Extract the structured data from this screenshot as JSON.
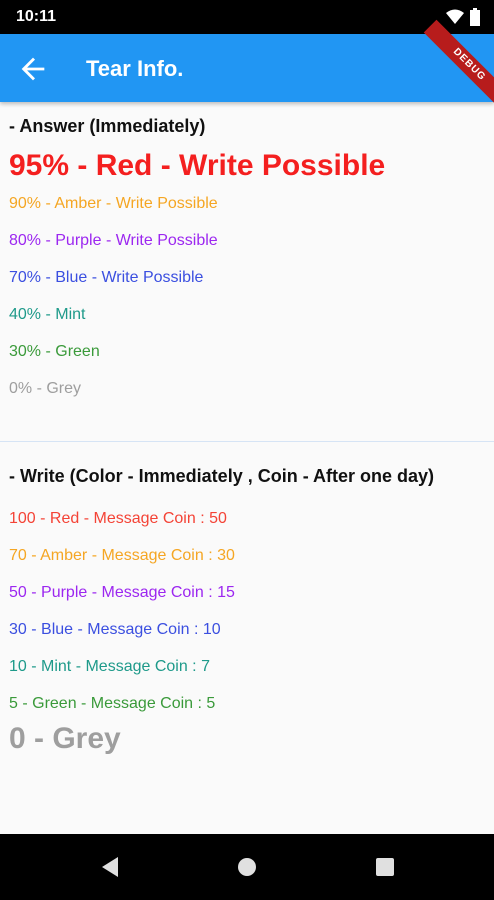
{
  "status_bar": {
    "time": "10:11"
  },
  "app_bar": {
    "title": "Tear Info.",
    "debug_banner": "DEBUG"
  },
  "answer": {
    "heading": "- Answer (Immediately)",
    "rows": [
      {
        "text": "95% - Red  - Write Possible",
        "color": "#f41f1f"
      },
      {
        "text": "90% - Amber  - Write Possible",
        "color": "#f5a623"
      },
      {
        "text": "80% - Purple  - Write Possible",
        "color": "#9c27f0"
      },
      {
        "text": "70% - Blue  - Write Possible",
        "color": "#3b4fe0"
      },
      {
        "text": "40% - Mint",
        "color": "#1e9a8a"
      },
      {
        "text": "30% - Green",
        "color": "#3a9a3a"
      },
      {
        "text": "0% - Grey",
        "color": "#9e9e9e"
      }
    ]
  },
  "write": {
    "heading": "- Write (Color - Immediately , Coin - After one day)",
    "rows": [
      {
        "text": "100 - Red  - Message Coin : 50",
        "color": "#f44336"
      },
      {
        "text": "70 - Amber  - Message Coin : 30",
        "color": "#f5a623"
      },
      {
        "text": "50 - Purple  - Message Coin : 15",
        "color": "#9c27f0"
      },
      {
        "text": "30 - Blue  - Message Coin : 10",
        "color": "#3b4fe0"
      },
      {
        "text": "10 - Mint  - Message Coin : 7",
        "color": "#1e9a8a"
      },
      {
        "text": "5 - Green  - Message Coin : 5",
        "color": "#3a9a3a"
      },
      {
        "text": "0 - Grey",
        "color": "#9e9e9e"
      }
    ]
  }
}
